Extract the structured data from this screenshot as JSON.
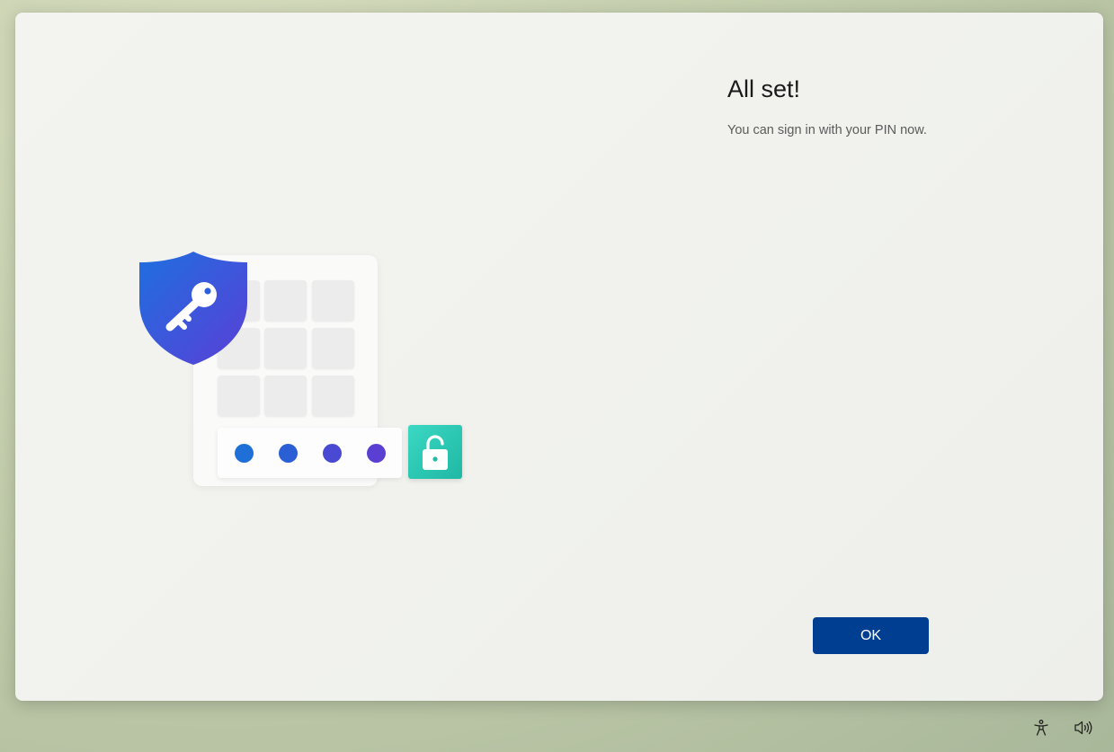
{
  "dialog": {
    "title": "All set!",
    "message": "You can sign in with your PIN now.",
    "ok_label": "OK"
  },
  "illustration": {
    "shield_icon": "shield-key-icon",
    "lock_icon": "unlocked-padlock-icon",
    "pin_dots": 4,
    "colors": {
      "shield_top": "#1f6fe0",
      "shield_bottom": "#5a3fd6",
      "lock_tile": "#22c2ae",
      "pin_dot_1": "#1f6fd8",
      "pin_dot_2": "#2a5fd6",
      "pin_dot_3": "#4a49d3",
      "pin_dot_4": "#5b3fd2"
    }
  },
  "taskbar": {
    "accessibility_icon": "accessibility-icon",
    "volume_icon": "volume-icon"
  },
  "colors": {
    "accent": "#003e92",
    "background": "#f2f2ee"
  }
}
